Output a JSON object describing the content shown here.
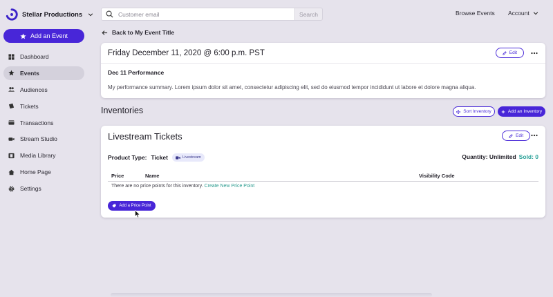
{
  "brand": {
    "name": "Stellar Productions"
  },
  "sidebar": {
    "add_event_label": "Add an Event",
    "items": [
      {
        "label": "Dashboard",
        "icon": "dashboard-icon"
      },
      {
        "label": "Events",
        "icon": "star-icon"
      },
      {
        "label": "Audiences",
        "icon": "people-icon"
      },
      {
        "label": "Tickets",
        "icon": "ticket-icon"
      },
      {
        "label": "Transactions",
        "icon": "transactions-icon"
      },
      {
        "label": "Stream Studio",
        "icon": "camera-icon"
      },
      {
        "label": "Media Library",
        "icon": "film-icon"
      },
      {
        "label": "Home Page",
        "icon": "home-icon"
      },
      {
        "label": "Settings",
        "icon": "gear-icon"
      }
    ],
    "active": "Events"
  },
  "topbar": {
    "search_placeholder": "Customer email",
    "search_button": "Search",
    "browse_events": "Browse Events",
    "account": "Account"
  },
  "back_link": "Back to My Event Title",
  "performance": {
    "title": "Friday December 11, 2020 @ 6:00 p.m. PST",
    "edit_label": "Edit",
    "name": "Dec 11 Performance",
    "summary": "My performance summary. Lorem ipsum dolor sit amet, consectetur adipiscing elit, sed do eiusmod tempor incididunt ut labore et dolore magna aliqua."
  },
  "inventories": {
    "heading": "Inventories",
    "sort_label": "Sort Inventory",
    "add_label": "Add an Inventory"
  },
  "inventory": {
    "title": "Livestream Tickets",
    "edit_label": "Edit",
    "product_type_label": "Product Type:",
    "product_type_value": "Ticket",
    "badge": "Livestream",
    "quantity": "Quantity: Unlimited",
    "sold": "Sold: 0",
    "columns": [
      "Price",
      "Name",
      "Visibility Code"
    ],
    "empty_text": "There are no price points for this inventory.",
    "empty_link": "Create New Price Point",
    "add_price_point": "Add a Price Point"
  },
  "colors": {
    "accent": "#4826d8",
    "teal": "#2aa198",
    "background": "#e6e3ec"
  }
}
